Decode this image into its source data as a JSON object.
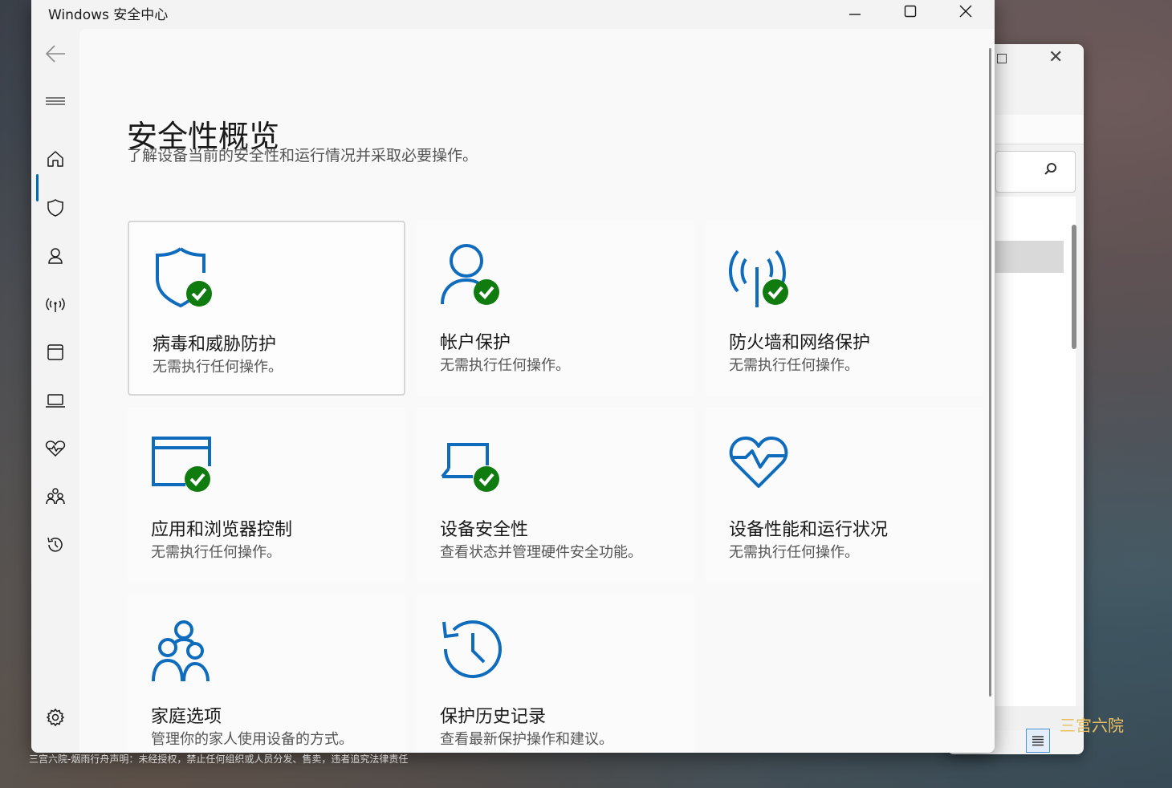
{
  "window": {
    "title": "Windows 安全中心"
  },
  "page": {
    "title": "安全性概览",
    "subtitle": "了解设备当前的安全性和运行情况并采取必要操作。"
  },
  "cards": [
    {
      "title": "病毒和威胁防护",
      "desc": "无需执行任何操作。"
    },
    {
      "title": "帐户保护",
      "desc": "无需执行任何操作。"
    },
    {
      "title": "防火墙和网络保护",
      "desc": "无需执行任何操作。"
    },
    {
      "title": "应用和浏览器控制",
      "desc": "无需执行任何操作。"
    },
    {
      "title": "设备安全性",
      "desc": "查看状态并管理硬件安全功能。"
    },
    {
      "title": "设备性能和运行状况",
      "desc": "无需执行任何操作。"
    },
    {
      "title": "家庭选项",
      "desc": "管理你的家人使用设备的方式。"
    },
    {
      "title": "保护历史记录",
      "desc": "查看最新保护操作和建议。"
    }
  ],
  "colors": {
    "accent_blue": "#0f6cbd",
    "status_green": "#107c10"
  },
  "watermark": {
    "text": "三宫六院-烟雨行舟声明：未经授权，禁止任何组织或人员分发、售卖，违者追究法律责任",
    "logo": "三宫六院"
  }
}
